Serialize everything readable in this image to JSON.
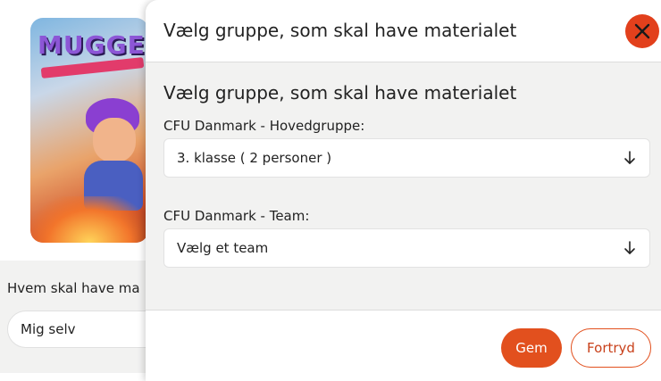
{
  "background": {
    "poster": {
      "title": "MUGGE",
      "alt": "Mugge movie poster"
    },
    "recipient_label": "Hvem skal have ma",
    "recipient_select_value": "Mig selv"
  },
  "modal": {
    "header_title": "Vælg gruppe, som skal have materialet",
    "close_icon": "close-icon",
    "body_title": "Vælg gruppe, som skal have materialet",
    "fields": [
      {
        "label": "CFU Danmark - Hovedgruppe:",
        "value": "3. klasse ( 2 personer )",
        "icon": "arrow-down-icon"
      },
      {
        "label": "CFU Danmark - Team:",
        "value": "Vælg et team",
        "icon": "arrow-down-icon"
      }
    ],
    "buttons": {
      "save_label": "Gem",
      "cancel_label": "Fortryd"
    }
  },
  "colors": {
    "accent": "#e2501e",
    "close_bg": "#e2401c",
    "panel_bg": "#f2f2f1"
  }
}
